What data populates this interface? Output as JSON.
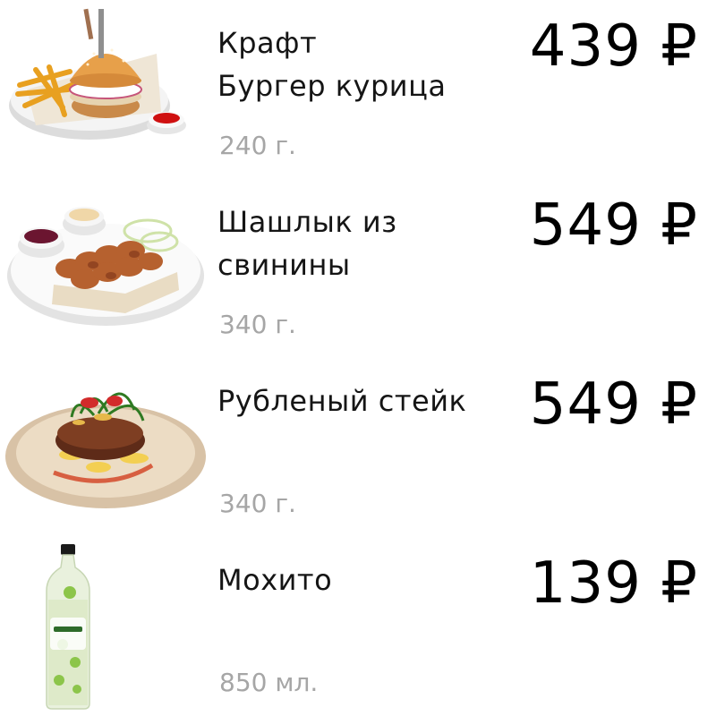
{
  "items": [
    {
      "name": "Крафт\nБургер курица",
      "weight": "240 г.",
      "price": "439 ₽",
      "image": "burger-chicken-image"
    },
    {
      "name": "Шашлык из\nсвинины",
      "weight": "340 г.",
      "price": "549 ₽",
      "image": "pork-shashlik-image"
    },
    {
      "name": "Рубленый стейк",
      "weight": "340 г.",
      "price": "549 ₽",
      "image": "chopped-steak-image"
    },
    {
      "name": "Мохито",
      "weight": "850 мл.",
      "price": "139 ₽",
      "image": "mojito-bottle-image"
    }
  ]
}
